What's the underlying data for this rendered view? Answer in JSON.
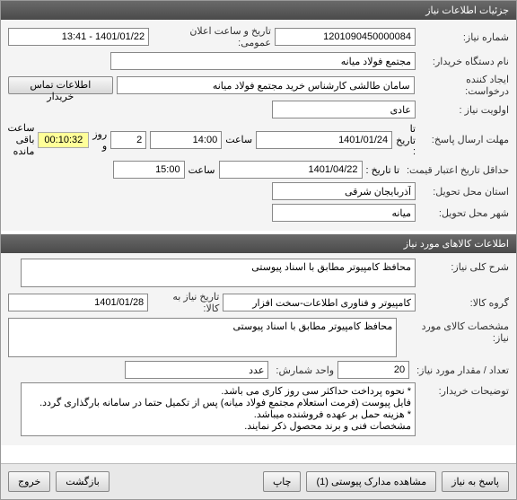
{
  "window": {
    "title": "جزئیات اطلاعات نیاز"
  },
  "header": {
    "req_no_label": "شماره نیاز:",
    "req_no": "1201090450000084",
    "announce_label": "تاریخ و ساعت اعلان عمومی:",
    "announce": "1401/01/22 - 13:41",
    "buyer_label": "نام دستگاه خریدار:",
    "buyer": "مجتمع فولاد میانه",
    "creator_label": "ایجاد کننده درخواست:",
    "creator": "سامان طالشی کارشناس خرید مجتمع فولاد میانه",
    "contact_btn": "اطلاعات تماس خریدار",
    "priority_label": "اولویت نیاز :",
    "priority": "عادی",
    "deadline_label": "مهلت ارسال پاسخ:",
    "to_date_label": "تا تاریخ :",
    "deadline_date": "1401/01/24",
    "time_label": "ساعت",
    "deadline_time": "14:00",
    "days": "2",
    "days_label": "روز و",
    "countdown": "00:10:32",
    "remain_label": "ساعت باقی مانده",
    "validity_label": "حداقل تاریخ اعتبار قیمت:",
    "validity_date": "1401/04/22",
    "validity_time": "15:00",
    "province_label": "استان محل تحویل:",
    "province": "آذربایجان شرقی",
    "city_label": "شهر محل تحویل:",
    "city": "میانه"
  },
  "items_section": {
    "title": "اطلاعات کالاهای مورد نیاز"
  },
  "items": {
    "desc_label": "شرح کلی نیاز:",
    "desc": "محافظ کامپیوتر مطابق با اسناد پیوستی",
    "group_label": "گروه کالا:",
    "group": "کامپیوتر و فناوری اطلاعات-سخت افزار",
    "need_date_label": "تاریخ نیاز به کالا:",
    "need_date": "1401/01/28",
    "spec_label": "مشخصات کالای مورد نیاز:",
    "spec": "محافظ کامپیوتر مطابق با اسناد پیوستی",
    "qty_label": "تعداد / مقدار مورد نیاز:",
    "qty": "20",
    "unit_label": "واحد شمارش:",
    "unit": "عدد",
    "notes_label": "توضیحات خریدار:",
    "notes": "* نحوه پرداخت حداکثر سی روز کاری می باشد.\nفایل پیوست (فرمت استعلام مجتمع فولاد میانه) پس از تکمیل حتما در سامانه بارگذاری گردد.\n* هزینه حمل بر عهده فروشنده میباشد.\nمشخصات فنی و برند محصول ذکر نمایند."
  },
  "footer": {
    "reply": "پاسخ به نیاز",
    "attachments": "مشاهده مدارک پیوستی (1)",
    "print": "چاپ",
    "back": "بازگشت",
    "exit": "خروج"
  }
}
